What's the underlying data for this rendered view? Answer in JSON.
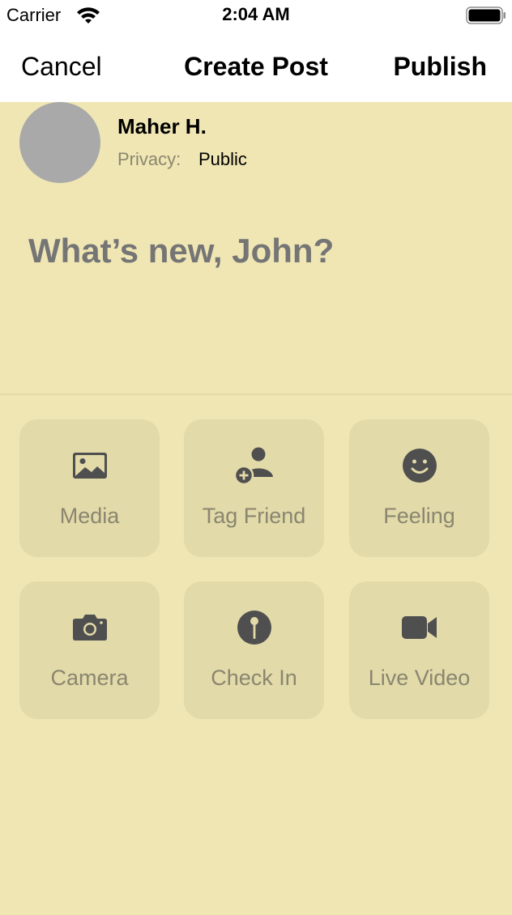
{
  "status_bar": {
    "carrier": "Carrier",
    "time": "2:04 AM",
    "icons": [
      "wifi-icon",
      "battery-icon"
    ]
  },
  "nav": {
    "cancel_label": "Cancel",
    "title": "Create Post",
    "publish_label": "Publish"
  },
  "composer": {
    "user_name": "Maher H.",
    "privacy_label": "Privacy:",
    "privacy_value": "Public",
    "placeholder": "What’s new, John?",
    "value": ""
  },
  "actions": [
    {
      "label": "Media",
      "icon": "image-icon"
    },
    {
      "label": "Tag Friend",
      "icon": "person-add-icon"
    },
    {
      "label": "Feeling",
      "icon": "smiley-icon"
    },
    {
      "label": "Camera",
      "icon": "camera-icon"
    },
    {
      "label": "Check In",
      "icon": "location-pin-icon"
    },
    {
      "label": "Live Video",
      "icon": "video-camera-icon"
    }
  ],
  "colors": {
    "background": "#f0e6b4",
    "tile": "#e2daa9",
    "icon": "#4f4f4f",
    "label": "#8a8670",
    "placeholder": "#d6cda6",
    "avatar": "#a9a9a9"
  }
}
